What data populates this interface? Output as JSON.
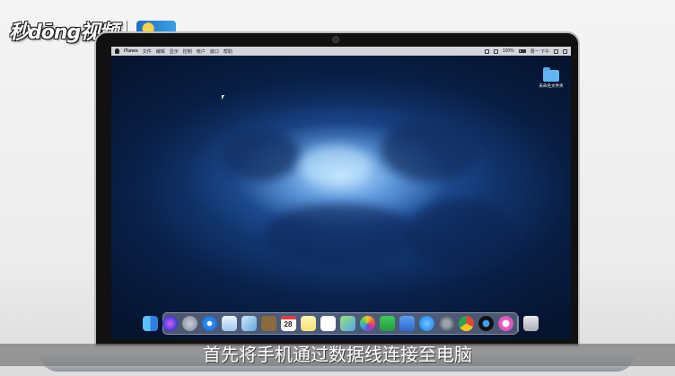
{
  "watermark": {
    "logo_text": "秒dōng视频",
    "partner_logo": "partner-logo"
  },
  "menubar": {
    "app_name": "iTunes",
    "items": [
      "文件",
      "编辑",
      "显示",
      "控制",
      "帐户",
      "窗口",
      "帮助"
    ],
    "battery": "100%",
    "clock": "周一 下午"
  },
  "desktop": {
    "folder_label": "未命名文件夹"
  },
  "dock": {
    "calendar_day": "28",
    "apps": [
      "finder-icon",
      "siri-icon",
      "launchpad-icon",
      "safari-icon",
      "mail-icon",
      "photos-app-icon",
      "notebook-icon",
      "calendar-icon",
      "notes-icon",
      "reminders-icon",
      "maps-icon",
      "photos-icon",
      "numbers-icon",
      "keynote-icon",
      "app-store-icon",
      "system-preferences-icon",
      "chrome-icon",
      "photo-booth-icon",
      "itunes-icon",
      "trash-icon"
    ]
  },
  "caption": {
    "text": "首先将手机通过数据线连接至电脑"
  }
}
